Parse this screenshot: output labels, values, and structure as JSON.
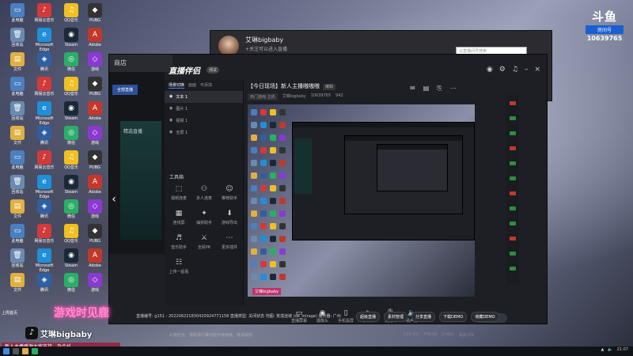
{
  "desktop": {
    "icons": [
      {
        "label": "此电脑",
        "color": "#4a7fc0",
        "glyph": "▭"
      },
      {
        "label": "网易云音乐",
        "color": "#d23a3a",
        "glyph": "♪"
      },
      {
        "label": "QQ音乐",
        "color": "#f0c020",
        "glyph": "♫"
      },
      {
        "label": "PUBG",
        "color": "#333",
        "glyph": "◆"
      },
      {
        "label": "回收站",
        "color": "#6a8bb0",
        "glyph": "🗑"
      },
      {
        "label": "Microsoft Edge",
        "color": "#1e8fd8",
        "glyph": "e"
      },
      {
        "label": "Steam",
        "color": "#1b2838",
        "glyph": "◉"
      },
      {
        "label": "Adobe",
        "color": "#c0392b",
        "glyph": "A"
      },
      {
        "label": "文件",
        "color": "#e0b040",
        "glyph": "▤"
      },
      {
        "label": "腾讯",
        "color": "#2f5fa0",
        "glyph": "◈"
      },
      {
        "label": "微信",
        "color": "#2aae67",
        "glyph": "◎"
      },
      {
        "label": "游戏",
        "color": "#8a3ad0",
        "glyph": "◇"
      }
    ],
    "bottom_label": "上周首页"
  },
  "logo": {
    "mark": "斗鱼",
    "sub": "房间号",
    "room_number": "10639765"
  },
  "back_window": {
    "streamer_name": "艾琳bigbaby",
    "subtitle": "+关注可以进入直播",
    "search_placeholder": "以直播间号搜索"
  },
  "mall": {
    "title": "商店",
    "tab": "全部直播",
    "tile_label": "精选直播"
  },
  "app": {
    "logo": "直播伴侣",
    "badge": "测试",
    "scene_tabs": [
      "场景切换",
      "画面",
      "可添加"
    ],
    "scenes": [
      "文本 1",
      "图片 1",
      "视频 1",
      "全屏 1"
    ],
    "tools_title": "工具箱",
    "tools": [
      {
        "label": "视频连麦",
        "icon": "⬚"
      },
      {
        "label": "多人连麦",
        "icon": "⚇"
      },
      {
        "label": "推荐助手",
        "icon": "☺"
      },
      {
        "label": "连线屏",
        "icon": "▦"
      },
      {
        "label": "抽奖助手",
        "icon": "✦"
      },
      {
        "label": "游戏导出",
        "icon": "⬇"
      },
      {
        "label": "音乐助手",
        "icon": "♬"
      },
      {
        "label": "全民PK",
        "icon": "⚔"
      },
      {
        "label": "更多插件",
        "icon": "⋯"
      },
      {
        "label": "上传一起看",
        "icon": "☷"
      },
      {
        "label": "",
        "icon": ""
      },
      {
        "label": "",
        "icon": ""
      }
    ]
  },
  "preview": {
    "title": "【今日现场】新人主播嗷嗷嗷",
    "tag": "编辑",
    "meta": [
      "热门游戏·主机",
      "艾琳bigbaby",
      "10639765",
      "942"
    ],
    "live_badge": "艾琳bigbaby"
  },
  "bottom_tools": [
    {
      "label": "直播屏幕",
      "icon": "▭"
    },
    {
      "label": "摄像头",
      "icon": "◉"
    },
    {
      "label": "手机投屏",
      "icon": "▯"
    },
    {
      "label": "多媒体",
      "icon": "▷"
    },
    {
      "label": "麦克风",
      "icon": "🎙"
    },
    {
      "label": "扬声器",
      "icon": "🔈"
    }
  ],
  "go_live": "开始直播",
  "notice": "礼物任务、观看排行等功能升级咯哦，敬请期待",
  "stats": [
    "CPU 0%",
    "FPS 60",
    "0 kb/s",
    "丢帧 0%"
  ],
  "room": {
    "info": "直播编号: g151 - 202206221830420924771158  直播类型: 关闭状态  地图: 荒漠迷城 (de_mirage)  服务器: 广州",
    "buttons": [
      "超级直播",
      "素材管理",
      "分享直播",
      "下载DEMO",
      "收藏DEMO"
    ]
  },
  "overlay": {
    "neon_title": "游戏时见鹿",
    "tt_name": "艾琳bigbaby",
    "ticker": "新人主播感谢大家支持，办个抖"
  },
  "taskbar": {
    "time": "21:07"
  }
}
